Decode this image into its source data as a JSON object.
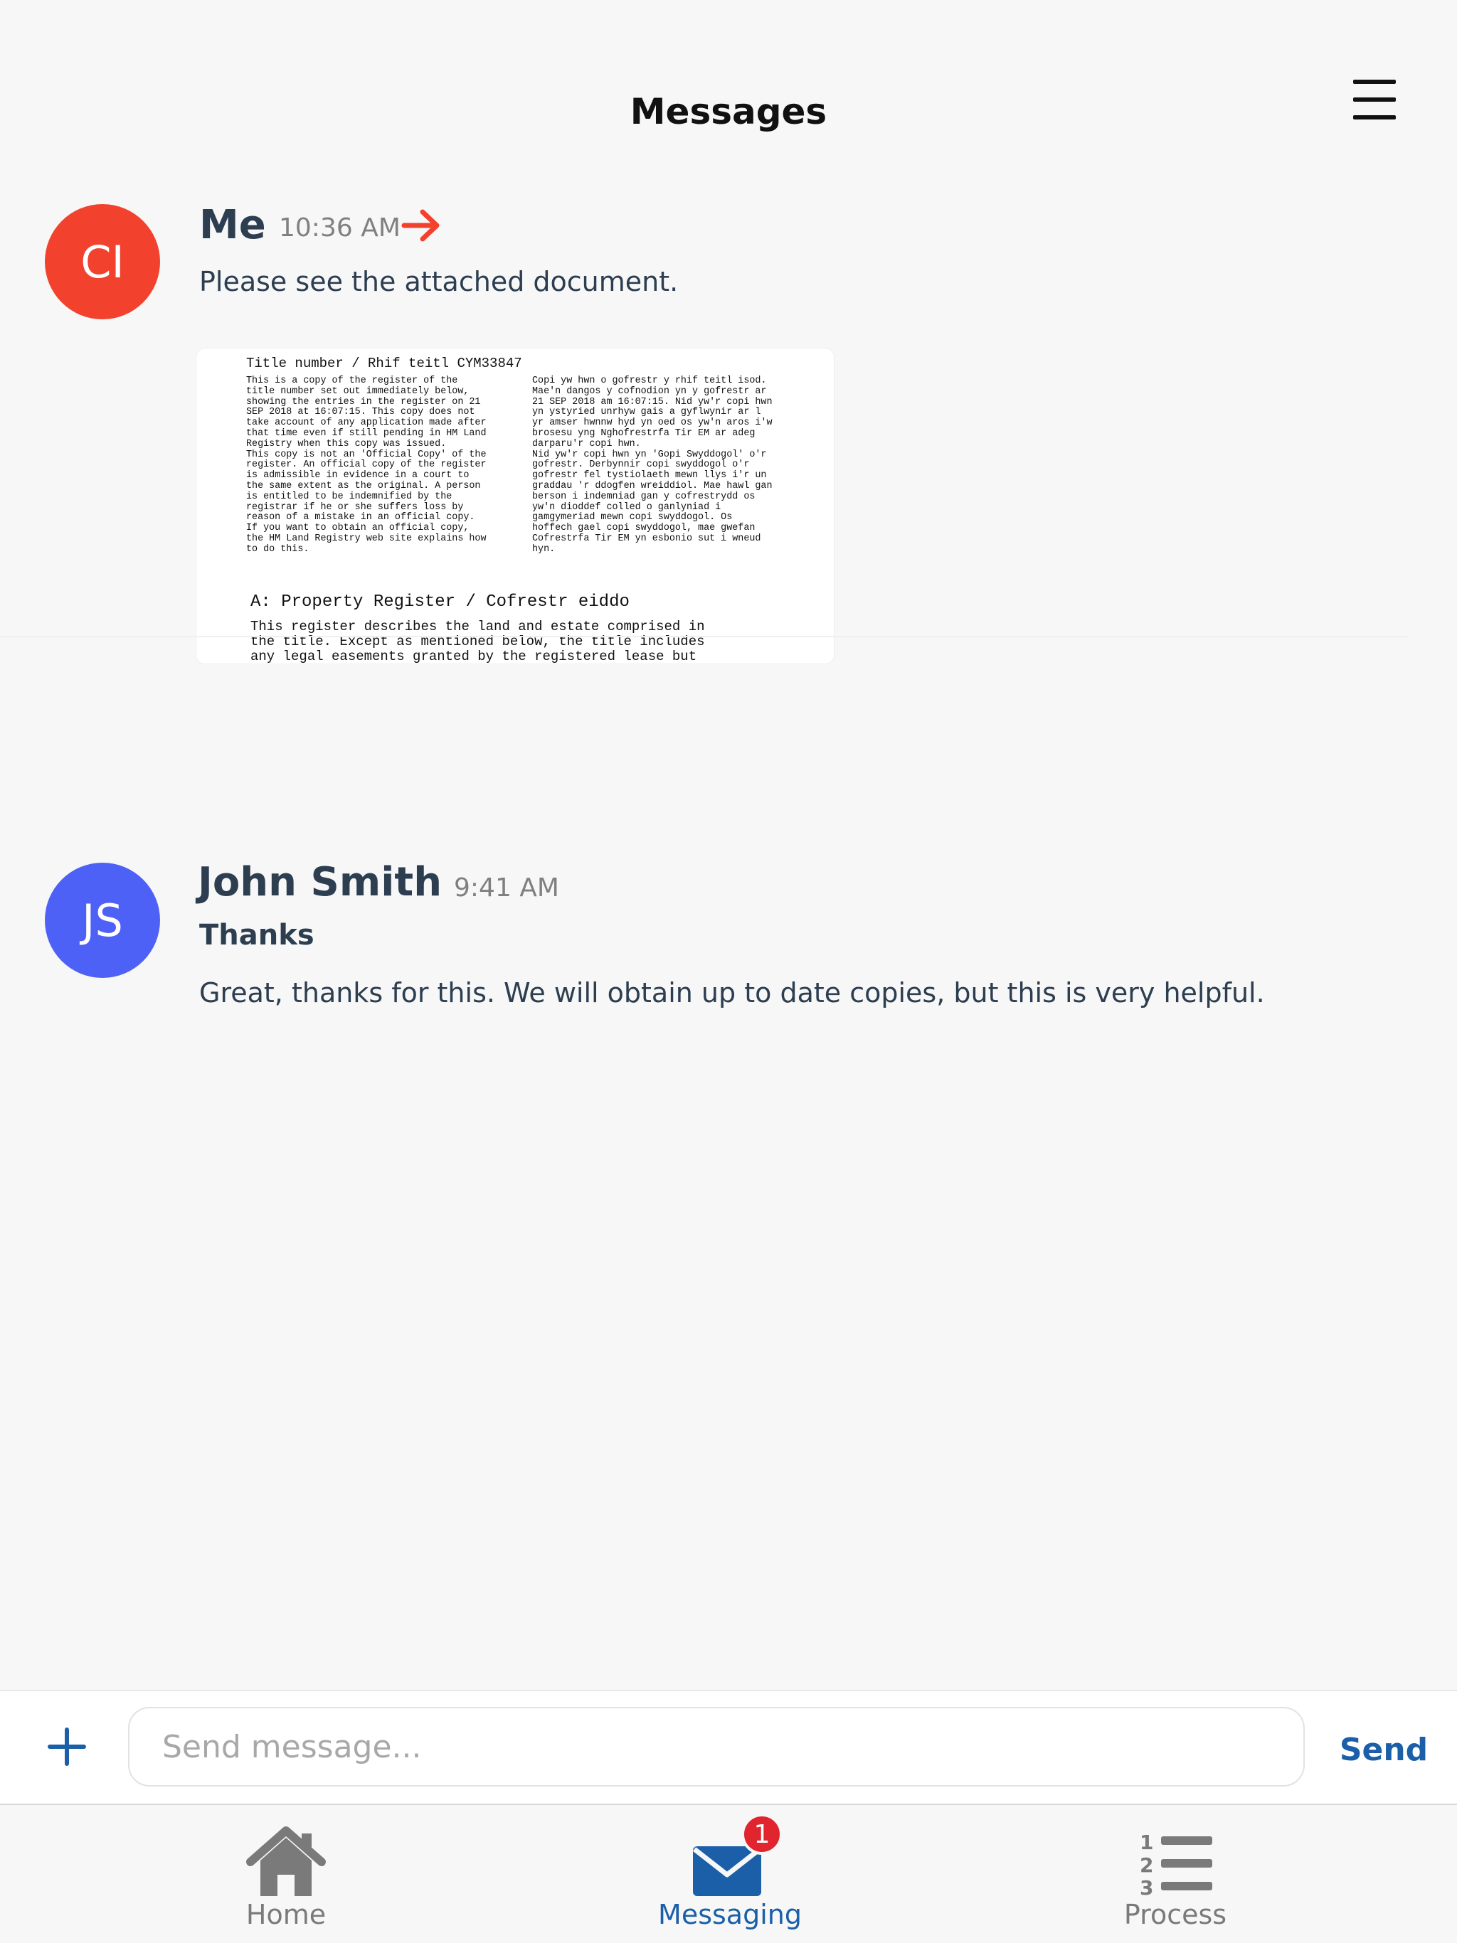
{
  "header": {
    "title": "Messages",
    "menu_icon": "hamburger-menu-icon"
  },
  "messages": [
    {
      "avatar_initials": "CI",
      "avatar_color": "#f2422e",
      "sender": "Me",
      "time": "10:36 AM",
      "status_icon": "arrow-right-icon",
      "text": "Please see the attached document.",
      "attachment": {
        "title_line": "Title number / Rhif teitl  CYM33847",
        "col_left": "This is a copy of the register of the\ntitle number set out immediately below,\nshowing the entries in the register on 21\nSEP 2018 at 16:07:15. This copy does not\ntake account of any application made after\nthat time even if still pending in HM Land\nRegistry when this copy was issued.\nThis copy is not an 'Official Copy' of the\nregister. An official copy of the register\nis admissible in evidence in a court to\nthe same extent as the original. A person\nis entitled to be indemnified by the\nregistrar if he or she suffers loss by\nreason of a mistake in an official copy.\nIf you want to obtain an official copy,\nthe HM Land Registry web site explains how\nto do this.",
        "col_right": "Copi yw hwn o gofrestr y rhif teitl isod.\nMae'n dangos y cofnodion yn y gofrestr ar\n21 SEP 2018 am 16:07:15. Nid yw'r copi hwn\nyn ystyried unrhyw gais a gyflwynir ar l\nyr amser hwnnw hyd yn oed os yw'n aros i'w\nbrosesu yng Nghofrestrfa Tir EM ar adeg\ndarparu'r copi hwn.\nNid yw'r copi hwn yn 'Gopi Swyddogol' o'r\ngofrestr.  Derbynnir copi swyddogol o'r\ngofrestr fel tystiolaeth mewn llys i'r un\ngraddau 'r ddogfen wreiddiol. Mae hawl gan\nberson i indemniad gan y cofrestrydd os\nyw'n dioddef colled o ganlyniad i\ngamgymeriad mewn copi swyddogol. Os\nhoffech gael copi swyddogol, mae gwefan\nCofrestrfa Tir EM yn esbonio sut i wneud\nhyn.",
        "section_title": "A: Property Register / Cofrestr eiddo",
        "body": "This register describes the land and estate comprised in\nthe title. Except as mentioned below, the title includes\nany legal easements granted by the registered lease but"
      }
    },
    {
      "avatar_initials": "JS",
      "avatar_color": "#4e61f6",
      "sender": "John Smith",
      "time": "9:41 AM",
      "subject": "Thanks",
      "text": "Great, thanks for this. We will obtain up to date copies, but this is very helpful."
    }
  ],
  "compose": {
    "add_icon": "plus-icon",
    "placeholder": "Send message...",
    "value": "",
    "send_label": "Send"
  },
  "tabs": [
    {
      "label": "Home",
      "icon": "home-icon",
      "active": false
    },
    {
      "label": "Messaging",
      "icon": "envelope-icon",
      "active": true,
      "badge": "1"
    },
    {
      "label": "Process",
      "icon": "numbered-list-icon",
      "active": false
    }
  ],
  "colors": {
    "accent": "#1a5fa8",
    "badge": "#e0252f",
    "text": "#2c3e50"
  }
}
